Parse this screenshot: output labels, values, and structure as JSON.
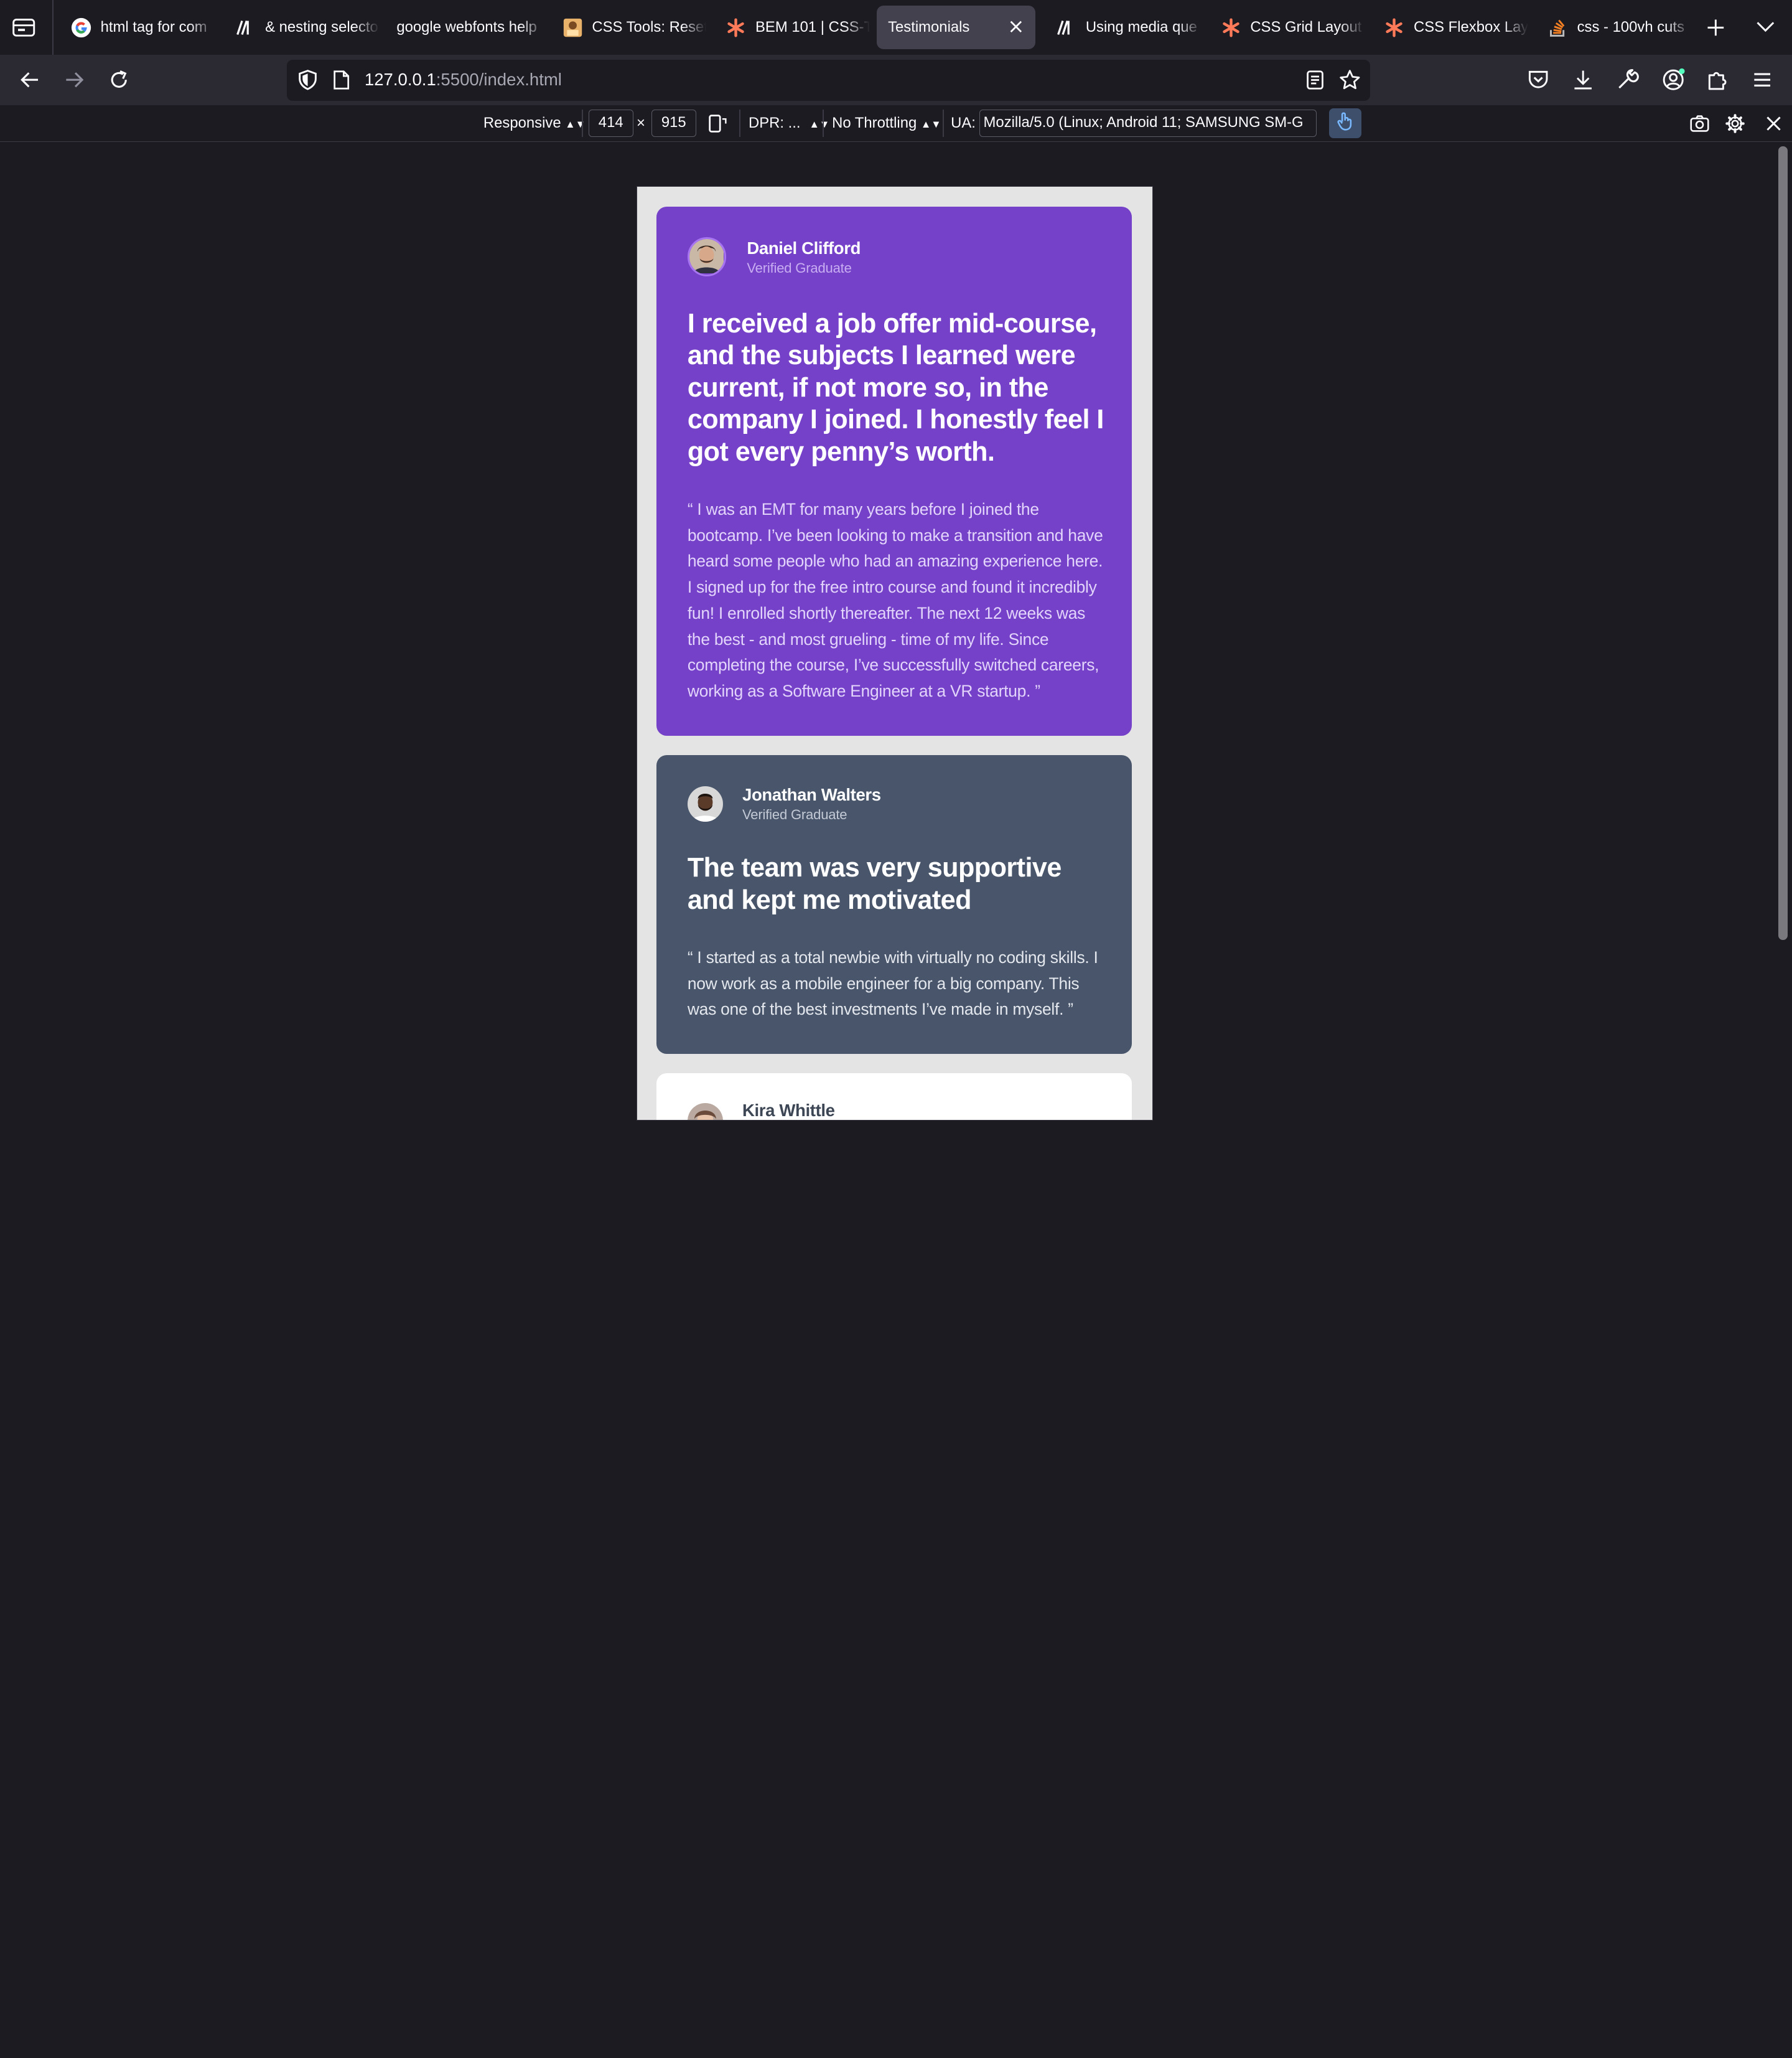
{
  "tabs": [
    {
      "title": "html tag for com",
      "icon": "google-icon"
    },
    {
      "title": "& nesting selecto",
      "icon": "mdn-icon"
    },
    {
      "title": "google webfonts help",
      "icon": "none"
    },
    {
      "title": "CSS Tools: Reset",
      "icon": "css-tools-icon"
    },
    {
      "title": "BEM 101 | CSS-Tricks",
      "icon": "css-tricks-icon"
    },
    {
      "title": "Testimonials",
      "icon": "none",
      "active": true
    },
    {
      "title": "Using media que",
      "icon": "mdn-icon"
    },
    {
      "title": "CSS Grid Layout",
      "icon": "css-tricks-icon"
    },
    {
      "title": "CSS Flexbox Lay",
      "icon": "css-tricks-icon"
    },
    {
      "title": "css - 100vh cuts",
      "icon": "stackoverflow-icon"
    }
  ],
  "url": {
    "host": "127.0.0.1",
    "rest": ":5500/index.html"
  },
  "rdm": {
    "device": "Responsive",
    "width": "414",
    "times": "×",
    "height": "915",
    "dpr": "DPR: ...",
    "throttle": "No Throttling",
    "ua_label": "UA:",
    "ua_value": "Mozilla/5.0 (Linux; Android 11; SAMSUNG SM-G"
  },
  "testimonials": [
    {
      "name": "Daniel Clifford",
      "role": "Verified Graduate",
      "headline": "I received a job offer mid-course, and the subjects I learned were current, if not more so, in the company I joined. I honestly feel I got every penny’s worth.",
      "quote": "“ I was an EMT for many years before I joined the bootcamp. I’ve been looking to make a transition and have heard some people who had an amazing experience here. I signed up for the free intro course and found it incredibly fun! I enrolled shortly thereafter. The next 12 weeks was the best - and most grueling - time of my life. Since completing the course, I’ve successfully switched careers, working as a Software Engineer at a VR startup. ”",
      "bg": "#7541c8"
    },
    {
      "name": "Jonathan Walters",
      "role": "Verified Graduate",
      "headline": "The team was very supportive and kept me motivated",
      "quote": "“ I started as a total newbie with virtually no coding skills. I now work as a mobile engineer for a big company. This was one of the best investments I’ve made in myself. ”",
      "bg": "#48556a"
    },
    {
      "name": "Kira Whittle",
      "bg": "#ffffff"
    }
  ]
}
